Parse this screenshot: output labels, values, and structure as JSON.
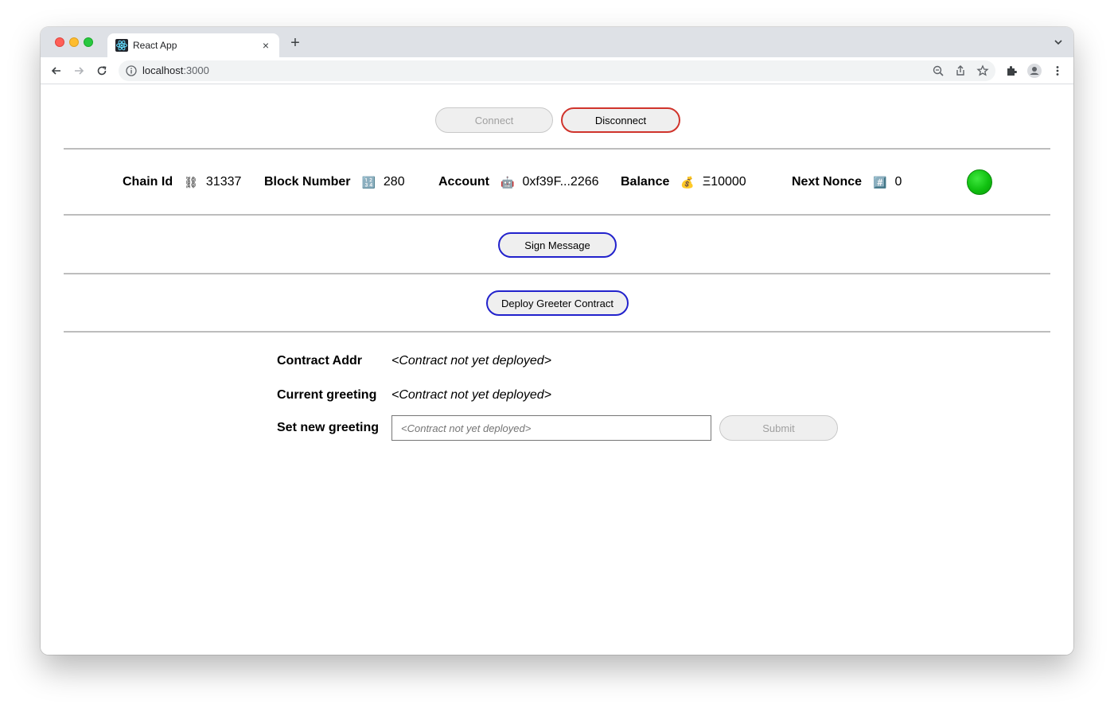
{
  "browser": {
    "tab_title": "React App",
    "tab_close": "×",
    "new_tab": "+",
    "url_host": "localhost",
    "url_port": ":3000"
  },
  "header": {
    "connect_label": "Connect",
    "disconnect_label": "Disconnect"
  },
  "info": {
    "chain_id_label": "Chain Id",
    "chain_id_icon": "⛓",
    "chain_id_value": "31337",
    "block_number_label": "Block Number",
    "block_number_icon": "🔢",
    "block_number_value": "280",
    "account_label": "Account",
    "account_icon": "🤖",
    "account_value": "0xf39F...2266",
    "balance_label": "Balance",
    "balance_icon": "💰",
    "balance_value": "Ξ10000",
    "nonce_label": "Next Nonce",
    "nonce_icon": "#️⃣",
    "nonce_value": "0",
    "status_color": "#10c010"
  },
  "actions": {
    "sign_label": "Sign Message",
    "deploy_label": "Deploy Greeter Contract"
  },
  "greeter": {
    "contract_addr_label": "Contract Addr",
    "contract_addr_value": "<Contract not yet deployed>",
    "current_greeting_label": "Current greeting",
    "current_greeting_value": "<Contract not yet deployed>",
    "set_greeting_label": "Set new greeting",
    "set_greeting_placeholder": "<Contract not yet deployed>",
    "submit_label": "Submit"
  },
  "colors": {
    "disconnect_border": "#d0342c",
    "action_border": "#2222cc"
  }
}
